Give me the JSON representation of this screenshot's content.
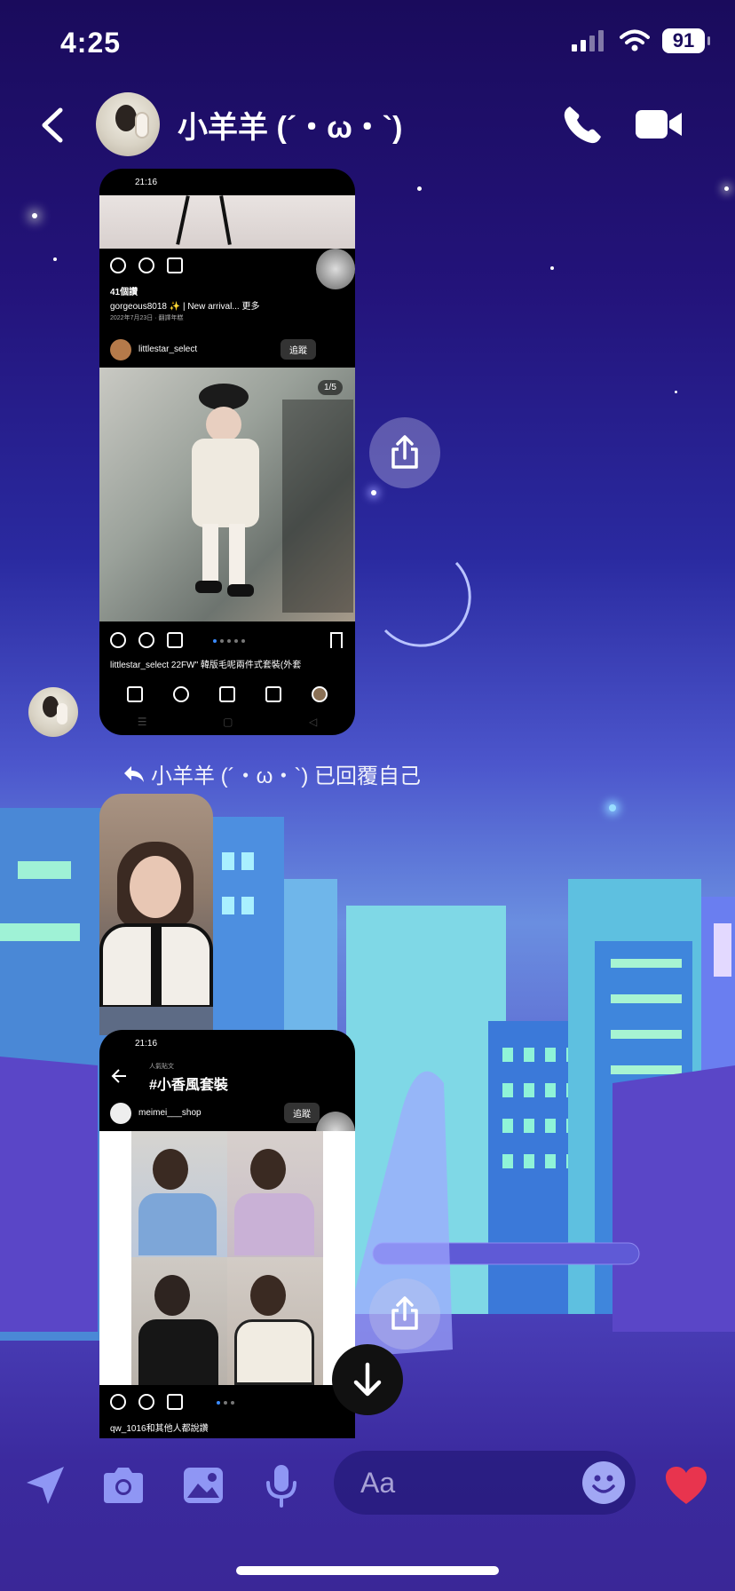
{
  "status_bar": {
    "time": "4:25",
    "battery": "91"
  },
  "header": {
    "contact_name": "小羊羊 (´・ω・`)",
    "icons": [
      "back-icon",
      "phone-icon",
      "video-camera-icon"
    ]
  },
  "messages": {
    "shot1": {
      "status_time": "21:16",
      "likes": "41個讚",
      "caption": "gorgeous8018 ✨ | New arrival... 更多",
      "date": "2022年7月23日 · 翻譯年糕",
      "account": "littlestar_select",
      "follow": "追蹤",
      "counter": "1/5",
      "caption2": "littlestar_select 22FW\" 韓版毛呢兩件式套裝(外套"
    },
    "reply_label": "小羊羊 (´・ω・`) 已回覆自己",
    "shot3": {
      "status_time": "21:16",
      "subtitle": "人氣貼文",
      "hashtag": "#小香風套裝",
      "account": "meimei___shop",
      "follow": "追蹤",
      "likes_line": "qw_1016和其他人都說讚"
    }
  },
  "composer": {
    "placeholder": "Aa",
    "icons": [
      "location-arrow-icon",
      "camera-icon",
      "gallery-icon",
      "microphone-icon",
      "emoji-icon",
      "heart-icon"
    ]
  },
  "colors": {
    "accent": "#4a3fb8",
    "heart": "#e8344e"
  }
}
